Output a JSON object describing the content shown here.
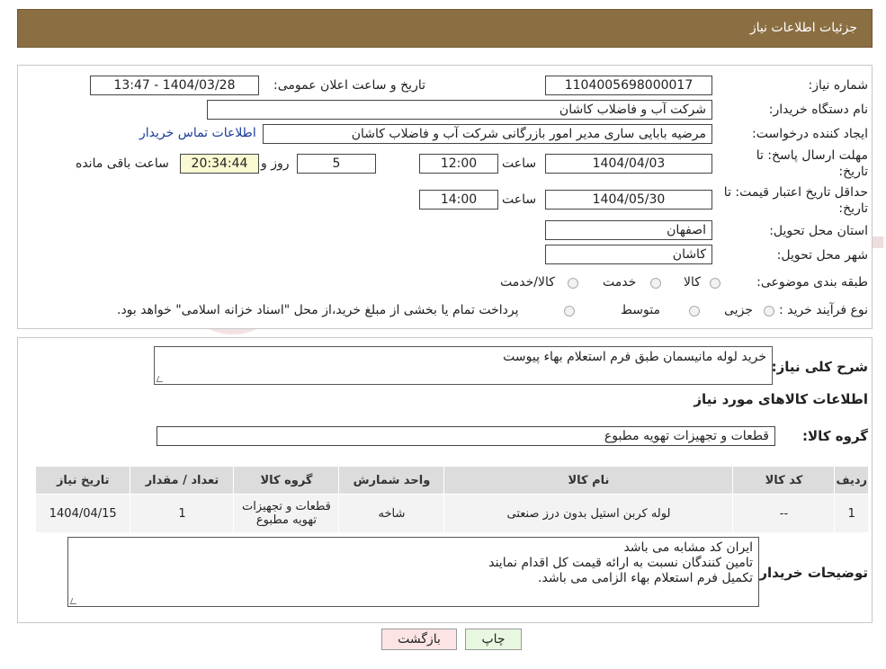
{
  "header": {
    "title": "جزئیات اطلاعات نیاز"
  },
  "form": {
    "need_number_label": "شماره نیاز:",
    "need_number": "1104005698000017",
    "announce_label": "تاریخ و ساعت اعلان عمومی:",
    "announce_value": "1404/03/28 - 13:47",
    "buyer_org_label": "نام دستگاه خریدار:",
    "buyer_org": "شرکت آب و فاضلاب کاشان",
    "creator_label": "ایجاد کننده درخواست:",
    "creator": "مرضیه بابایی ساری مدیر امور بازرگانی شرکت آب و فاضلاب کاشان",
    "contact_link": "اطلاعات تماس خریدار",
    "deadline_label_1": "مهلت ارسال پاسخ: تا",
    "deadline_label_2": "تاریخ:",
    "deadline_date": "1404/04/03",
    "time_label": "ساعت",
    "deadline_time": "12:00",
    "days_value": "5",
    "days_label": "روز و",
    "remaining_time": "20:34:44",
    "remaining_label": "ساعت باقی مانده",
    "validity_label_1": "حداقل تاریخ اعتبار قیمت: تا",
    "validity_label_2": "تاریخ:",
    "validity_date": "1404/05/30",
    "validity_time": "14:00",
    "province_label": "استان محل تحویل:",
    "province": "اصفهان",
    "city_label": "شهر محل تحویل:",
    "city": "کاشان",
    "category_label": "طبقه بندی موضوعی:",
    "category_options": [
      "کالا",
      "خدمت",
      "کالا/خدمت"
    ],
    "purchase_type_label": "نوع فرآیند خرید :",
    "purchase_options": [
      "جزیی",
      "متوسط"
    ],
    "purchase_note": "پرداخت تمام یا بخشی از مبلغ خرید،از محل \"اسناد خزانه اسلامی\" خواهد بود."
  },
  "details": {
    "summary_label": "شرح کلی نیاز:",
    "summary": "خرید لوله مانیسمان طبق فرم استعلام بهاء پیوست",
    "items_title": "اطلاعات کالاهای مورد نیاز",
    "group_label": "گروه کالا:",
    "group_value": "قطعات و تجهیزات تهویه مطبوع",
    "table": {
      "headers": [
        "ردیف",
        "کد کالا",
        "نام کالا",
        "واحد شمارش",
        "گروه کالا",
        "تعداد / مقدار",
        "تاریخ نیاز"
      ],
      "rows": [
        [
          "1",
          "--",
          "لوله کربن استیل بدون درز صنعتی",
          "شاخه",
          "قطعات و تجهیزات تهویه مطبوع",
          "1",
          "1404/04/15"
        ]
      ]
    },
    "buyer_notes_label": "توضیحات خریدار:",
    "buyer_notes": [
      "ایران کد مشابه می باشد",
      "تامین کنندگان نسبت به ارائه قیمت کل اقدام نمایند",
      "تکمیل فرم استعلام بهاء الزامی می باشد."
    ]
  },
  "buttons": {
    "print": "چاپ",
    "back": "بازگشت"
  },
  "watermark": "AriaTender.neT",
  "colors": {
    "header_bg": "#8b6f43",
    "link": "#1a3c9c",
    "print_bg": "#e8f8e0",
    "back_bg": "#fde4e4",
    "remaining_bg": "#fafad2"
  }
}
